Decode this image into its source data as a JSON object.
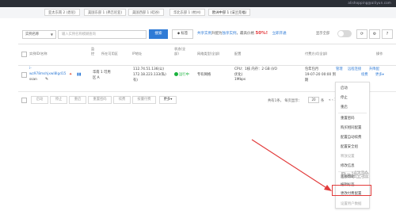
{
  "topbar": {
    "right_text": "alishopping@ailiyun.com"
  },
  "region_tabs": [
    {
      "label": "亚太东南 2 (悉尼)"
    },
    {
      "label": "美国东部 1 (弗吉尼亚)"
    },
    {
      "label": "美国西部 1 (硅谷)"
    },
    {
      "label": "华北东部 1 (杭州)"
    },
    {
      "label": "欧洲中部 1 (法兰克福)"
    }
  ],
  "toolbar": {
    "select_value": "实例名称",
    "search_placeholder": "输入实例名称模糊查询",
    "search_label": "搜索",
    "tag_label": "标签",
    "promo_prefix": "共享实例",
    "promo_mid": "升配为",
    "promo_highlight": "独享实例",
    "promo_suffix": "，最高价格",
    "promo_discount": "50%!",
    "promo_link": "立即开通",
    "toggle_label": "显示全部"
  },
  "table": {
    "headers": [
      "实例ID/名称",
      "监控",
      "所在可用区",
      "IP地址",
      "状态(全部)",
      "网络类型(全部)",
      "配置",
      "付费方式(全部)",
      "操作"
    ],
    "row": {
      "id_line1": "i-",
      "id_line2": "wz978mshjxwl8lgd15",
      "id_line3": "ssan",
      "zone_line1": "华南 1 可用",
      "zone_line2": "区 A",
      "ip_line1": "112.74.51.136(公)",
      "ip_line2": "172.18.223.133(私)",
      "ip_line3": "有)",
      "status": "运行中",
      "network": "专有网络",
      "config_line1": "CPU：1核  内存：2 GB (I/O",
      "config_line2": "优化)",
      "config_line3": "1Mbps",
      "pay_line1": "包年包月",
      "pay_line2": "19-07-20 00:00 到",
      "pay_line3": "期",
      "action_manage": "管理",
      "action_remote": "远程连接",
      "action_upgrade": "升降配",
      "action_renew": "续费",
      "action_more": "更多"
    }
  },
  "bottom_bar": {
    "buttons": [
      "启动",
      "停止",
      "重启",
      "重置密码",
      "续费",
      "按量付费"
    ],
    "more_label": "更多",
    "pager_total": "共有1条， 每页显示：",
    "page_size": "20",
    "page_unit": "条",
    "pager_nav": "«  ‹  1  ›  »"
  },
  "dropdown_menu": {
    "items": [
      {
        "label": "启动",
        "disabled": false
      },
      {
        "label": "停止",
        "disabled": false
      },
      {
        "label": "重启",
        "disabled": false
      },
      {
        "label": "重置密码",
        "disabled": false
      },
      {
        "label": "购买相同配置",
        "disabled": false
      },
      {
        "label": "配置自动续费",
        "disabled": false
      },
      {
        "label": "配置安全组",
        "disabled": false
      },
      {
        "label": "释放设置",
        "disabled": true
      },
      {
        "label": "修改信息",
        "disabled": false
      },
      {
        "label": "连接帮助",
        "disabled": false
      },
      {
        "label": "编辑标签",
        "disabled": false
      },
      {
        "label": "更改付费配置",
        "disabled": false
      },
      {
        "label": "设置用户数据",
        "disabled": true
      }
    ]
  },
  "watermark": "Bai经验",
  "colors": {
    "accent": "#2f7bd6",
    "highlight": "#e23b3b",
    "running": "#1ab33d"
  }
}
